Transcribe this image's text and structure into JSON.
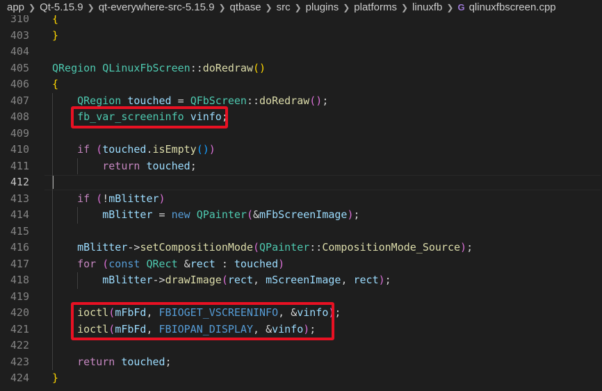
{
  "breadcrumb": {
    "items": [
      "app",
      "Qt-5.15.9",
      "qt-everywhere-src-5.15.9",
      "qtbase",
      "src",
      "plugins",
      "platforms",
      "linuxfb"
    ],
    "file": "qlinuxfbscreen.cpp",
    "file_icon": "C++ (G) file icon",
    "separator": "chevron-right-icon"
  },
  "editor": {
    "current_line": "412",
    "lines": [
      {
        "num": "310",
        "tokens": [
          {
            "t": "{",
            "c": "t-b1"
          }
        ]
      },
      {
        "num": "403",
        "tokens": [
          {
            "t": "}",
            "c": "t-b1"
          }
        ]
      },
      {
        "num": "404",
        "tokens": []
      },
      {
        "num": "405",
        "tokens": [
          {
            "t": "QRegion",
            "c": "t-type"
          },
          {
            "t": " ",
            "c": "t-plain"
          },
          {
            "t": "QLinuxFbScreen",
            "c": "t-type"
          },
          {
            "t": "::",
            "c": "t-plain"
          },
          {
            "t": "doRedraw",
            "c": "t-func"
          },
          {
            "t": "()",
            "c": "t-b1"
          }
        ]
      },
      {
        "num": "406",
        "tokens": [
          {
            "t": "{",
            "c": "t-b1"
          }
        ]
      },
      {
        "num": "407",
        "tokens": [
          {
            "t": "    ",
            "c": "t-plain"
          },
          {
            "t": "QRegion",
            "c": "t-type"
          },
          {
            "t": " ",
            "c": "t-plain"
          },
          {
            "t": "touched",
            "c": "t-var"
          },
          {
            "t": " = ",
            "c": "t-plain"
          },
          {
            "t": "QFbScreen",
            "c": "t-type"
          },
          {
            "t": "::",
            "c": "t-plain"
          },
          {
            "t": "doRedraw",
            "c": "t-func"
          },
          {
            "t": "()",
            "c": "t-b2"
          },
          {
            "t": ";",
            "c": "t-plain"
          }
        ]
      },
      {
        "num": "408",
        "tokens": [
          {
            "t": "    ",
            "c": "t-plain"
          },
          {
            "t": "fb_var_screeninfo",
            "c": "t-type"
          },
          {
            "t": " ",
            "c": "t-plain"
          },
          {
            "t": "vinfo",
            "c": "t-var"
          },
          {
            "t": ";",
            "c": "t-plain"
          }
        ]
      },
      {
        "num": "409",
        "tokens": []
      },
      {
        "num": "410",
        "tokens": [
          {
            "t": "    ",
            "c": "t-plain"
          },
          {
            "t": "if",
            "c": "t-ctrl"
          },
          {
            "t": " ",
            "c": "t-plain"
          },
          {
            "t": "(",
            "c": "t-b2"
          },
          {
            "t": "touched",
            "c": "t-var"
          },
          {
            "t": ".",
            "c": "t-plain"
          },
          {
            "t": "isEmpty",
            "c": "t-func"
          },
          {
            "t": "()",
            "c": "t-b3"
          },
          {
            "t": ")",
            "c": "t-b2"
          }
        ]
      },
      {
        "num": "411",
        "tokens": [
          {
            "t": "        ",
            "c": "t-plain"
          },
          {
            "t": "return",
            "c": "t-ctrl"
          },
          {
            "t": " ",
            "c": "t-plain"
          },
          {
            "t": "touched",
            "c": "t-var"
          },
          {
            "t": ";",
            "c": "t-plain"
          }
        ]
      },
      {
        "num": "412",
        "tokens": []
      },
      {
        "num": "413",
        "tokens": [
          {
            "t": "    ",
            "c": "t-plain"
          },
          {
            "t": "if",
            "c": "t-ctrl"
          },
          {
            "t": " ",
            "c": "t-plain"
          },
          {
            "t": "(",
            "c": "t-b2"
          },
          {
            "t": "!",
            "c": "t-plain"
          },
          {
            "t": "mBlitter",
            "c": "t-var"
          },
          {
            "t": ")",
            "c": "t-b2"
          }
        ]
      },
      {
        "num": "414",
        "tokens": [
          {
            "t": "        ",
            "c": "t-plain"
          },
          {
            "t": "mBlitter",
            "c": "t-var"
          },
          {
            "t": " = ",
            "c": "t-plain"
          },
          {
            "t": "new",
            "c": "t-kw"
          },
          {
            "t": " ",
            "c": "t-plain"
          },
          {
            "t": "QPainter",
            "c": "t-type"
          },
          {
            "t": "(",
            "c": "t-b2"
          },
          {
            "t": "&",
            "c": "t-plain"
          },
          {
            "t": "mFbScreenImage",
            "c": "t-var"
          },
          {
            "t": ")",
            "c": "t-b2"
          },
          {
            "t": ";",
            "c": "t-plain"
          }
        ]
      },
      {
        "num": "415",
        "tokens": []
      },
      {
        "num": "416",
        "tokens": [
          {
            "t": "    ",
            "c": "t-plain"
          },
          {
            "t": "mBlitter",
            "c": "t-var"
          },
          {
            "t": "->",
            "c": "t-plain"
          },
          {
            "t": "setCompositionMode",
            "c": "t-func"
          },
          {
            "t": "(",
            "c": "t-b2"
          },
          {
            "t": "QPainter",
            "c": "t-type"
          },
          {
            "t": "::",
            "c": "t-plain"
          },
          {
            "t": "CompositionMode_Source",
            "c": "t-func"
          },
          {
            "t": ")",
            "c": "t-b2"
          },
          {
            "t": ";",
            "c": "t-plain"
          }
        ]
      },
      {
        "num": "417",
        "tokens": [
          {
            "t": "    ",
            "c": "t-plain"
          },
          {
            "t": "for",
            "c": "t-ctrl"
          },
          {
            "t": " ",
            "c": "t-plain"
          },
          {
            "t": "(",
            "c": "t-b2"
          },
          {
            "t": "const",
            "c": "t-kw"
          },
          {
            "t": " ",
            "c": "t-plain"
          },
          {
            "t": "QRect",
            "c": "t-type"
          },
          {
            "t": " &",
            "c": "t-plain"
          },
          {
            "t": "rect",
            "c": "t-var"
          },
          {
            "t": " : ",
            "c": "t-plain"
          },
          {
            "t": "touched",
            "c": "t-var"
          },
          {
            "t": ")",
            "c": "t-b2"
          }
        ]
      },
      {
        "num": "418",
        "tokens": [
          {
            "t": "        ",
            "c": "t-plain"
          },
          {
            "t": "mBlitter",
            "c": "t-var"
          },
          {
            "t": "->",
            "c": "t-plain"
          },
          {
            "t": "drawImage",
            "c": "t-func"
          },
          {
            "t": "(",
            "c": "t-b2"
          },
          {
            "t": "rect",
            "c": "t-var"
          },
          {
            "t": ", ",
            "c": "t-plain"
          },
          {
            "t": "mScreenImage",
            "c": "t-var"
          },
          {
            "t": ", ",
            "c": "t-plain"
          },
          {
            "t": "rect",
            "c": "t-var"
          },
          {
            "t": ")",
            "c": "t-b2"
          },
          {
            "t": ";",
            "c": "t-plain"
          }
        ]
      },
      {
        "num": "419",
        "tokens": []
      },
      {
        "num": "420",
        "tokens": [
          {
            "t": "    ",
            "c": "t-plain"
          },
          {
            "t": "ioctl",
            "c": "t-func"
          },
          {
            "t": "(",
            "c": "t-b2"
          },
          {
            "t": "mFbFd",
            "c": "t-var"
          },
          {
            "t": ", ",
            "c": "t-plain"
          },
          {
            "t": "FBIOGET_VSCREENINFO",
            "c": "t-macro"
          },
          {
            "t": ", ",
            "c": "t-plain"
          },
          {
            "t": "&",
            "c": "t-plain"
          },
          {
            "t": "vinfo",
            "c": "t-var"
          },
          {
            "t": ")",
            "c": "t-b2"
          },
          {
            "t": ";",
            "c": "t-plain"
          }
        ]
      },
      {
        "num": "421",
        "tokens": [
          {
            "t": "    ",
            "c": "t-plain"
          },
          {
            "t": "ioctl",
            "c": "t-func"
          },
          {
            "t": "(",
            "c": "t-b2"
          },
          {
            "t": "mFbFd",
            "c": "t-var"
          },
          {
            "t": ", ",
            "c": "t-plain"
          },
          {
            "t": "FBIOPAN_DISPLAY",
            "c": "t-macro"
          },
          {
            "t": ", ",
            "c": "t-plain"
          },
          {
            "t": "&",
            "c": "t-plain"
          },
          {
            "t": "vinfo",
            "c": "t-var"
          },
          {
            "t": ")",
            "c": "t-b2"
          },
          {
            "t": ";",
            "c": "t-plain"
          }
        ]
      },
      {
        "num": "422",
        "tokens": []
      },
      {
        "num": "423",
        "tokens": [
          {
            "t": "    ",
            "c": "t-plain"
          },
          {
            "t": "return",
            "c": "t-ctrl"
          },
          {
            "t": " ",
            "c": "t-plain"
          },
          {
            "t": "touched",
            "c": "t-var"
          },
          {
            "t": ";",
            "c": "t-plain"
          }
        ]
      },
      {
        "num": "424",
        "tokens": [
          {
            "t": "}",
            "c": "t-b1"
          }
        ]
      }
    ]
  },
  "colors": {
    "background": "#1e1e1e",
    "annotation_box": "#e81123",
    "line_number": "#858585",
    "type": "#4ec9b0",
    "function": "#dcdcaa",
    "keyword": "#569cd6",
    "control": "#c586c0",
    "variable": "#9cdcfe"
  }
}
